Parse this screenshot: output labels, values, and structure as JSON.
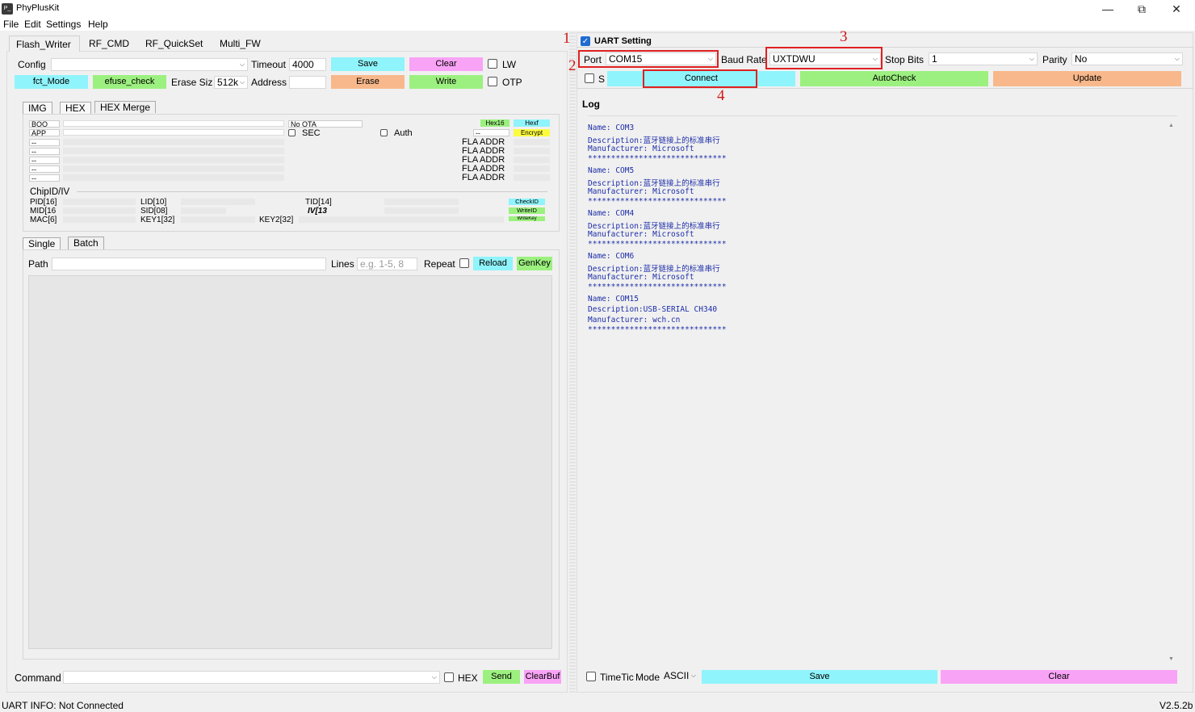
{
  "window": {
    "title": "PhyPlusKit",
    "icon_text": "P_",
    "minimize": "—",
    "restore": "⧉",
    "close": "✕"
  },
  "menu": [
    "File",
    "Edit",
    "Settings",
    "Help"
  ],
  "main_tabs": [
    "Flash_Writer",
    "RF_CMD",
    "RF_QuickSet",
    "Multi_FW"
  ],
  "flash": {
    "config_label": "Config",
    "config_value": "",
    "timeout_label": "Timeout",
    "timeout_value": "4000",
    "save": "Save",
    "clear": "Clear",
    "lw": "LW",
    "fct_mode": "fct_Mode",
    "efuse_check": "efuse_check",
    "erase_size_label": "Erase Siz",
    "erase_size_value": "512k",
    "address_label": "Address",
    "address_value": "",
    "erase": "Erase",
    "write": "Write",
    "otp": "OTP"
  },
  "sub_tabs": [
    "IMG",
    "HEX",
    "HEX Merge"
  ],
  "hex": {
    "boot": "BOO",
    "app": "APP",
    "dash": "--",
    "no_ota": "No OTA",
    "sec": "SEC",
    "auth": "Auth",
    "hex16": "Hex16",
    "hexf": "Hexf",
    "encrypt": "Encrypt",
    "fla_addr": "FLA  ADDR",
    "chipid": "ChipID/IV",
    "pid": "PID[16]",
    "lid": "LID[10]",
    "tid": "TID[14]",
    "check": "CheckID",
    "mid": "MID[16",
    "sid": "SID[08]",
    "iv": "IV[13",
    "writeid": "WriteID",
    "mac": "MAC[6]",
    "key1": "KEY1[32]",
    "key2": "KEY2[32]",
    "writekey": "WriteKey"
  },
  "batch_tabs": [
    "Single",
    "Batch"
  ],
  "batch": {
    "path_label": "Path",
    "path_value": "",
    "lines_label": "Lines",
    "lines_placeholder": "e.g. 1-5, 8",
    "repeat_label": "Repeat",
    "reload": "Reload",
    "genkey": "GenKey"
  },
  "command": {
    "label": "Command",
    "value": "",
    "hex": "HEX",
    "send": "Send",
    "clearbuf": "ClearBuf"
  },
  "uart": {
    "title": "UART Setting",
    "port_label": "Port",
    "port_value": "COM15",
    "baud_label": "Baud Rate",
    "baud_value": "UXTDWU",
    "stop_label": "Stop Bits",
    "stop_value": "1",
    "parity_label": "Parity",
    "parity_value": "No",
    "s_label": "S",
    "connect": "Connect",
    "autocheck": "AutoCheck",
    "update": "Update"
  },
  "log": {
    "title": "Log",
    "lines": [
      "Name: COM3",
      "Description:蓝牙链接上的标准串行",
      "Manufacturer: Microsoft",
      "******************************",
      "Name: COM5",
      "Description:蓝牙链接上的标准串行",
      "Manufacturer: Microsoft",
      "******************************",
      "Name: COM4",
      "Description:蓝牙链接上的标准串行",
      "Manufacturer: Microsoft",
      "******************************",
      "Name: COM6",
      "Description:蓝牙链接上的标准串行",
      "Manufacturer: Microsoft",
      "******************************",
      "Name: COM15",
      "Description:USB-SERIAL CH340",
      "Manufacturer: wch.cn",
      "******************************"
    ]
  },
  "log_bottom": {
    "timetic": "TimeTic",
    "mode_label": "Mode",
    "mode_value": "ASCII",
    "save": "Save",
    "clear": "Clear"
  },
  "annotations": [
    "1",
    "2",
    "3",
    "4"
  ],
  "status": {
    "info": "UART INFO: Not Connected",
    "version": "V2.5.2b"
  }
}
